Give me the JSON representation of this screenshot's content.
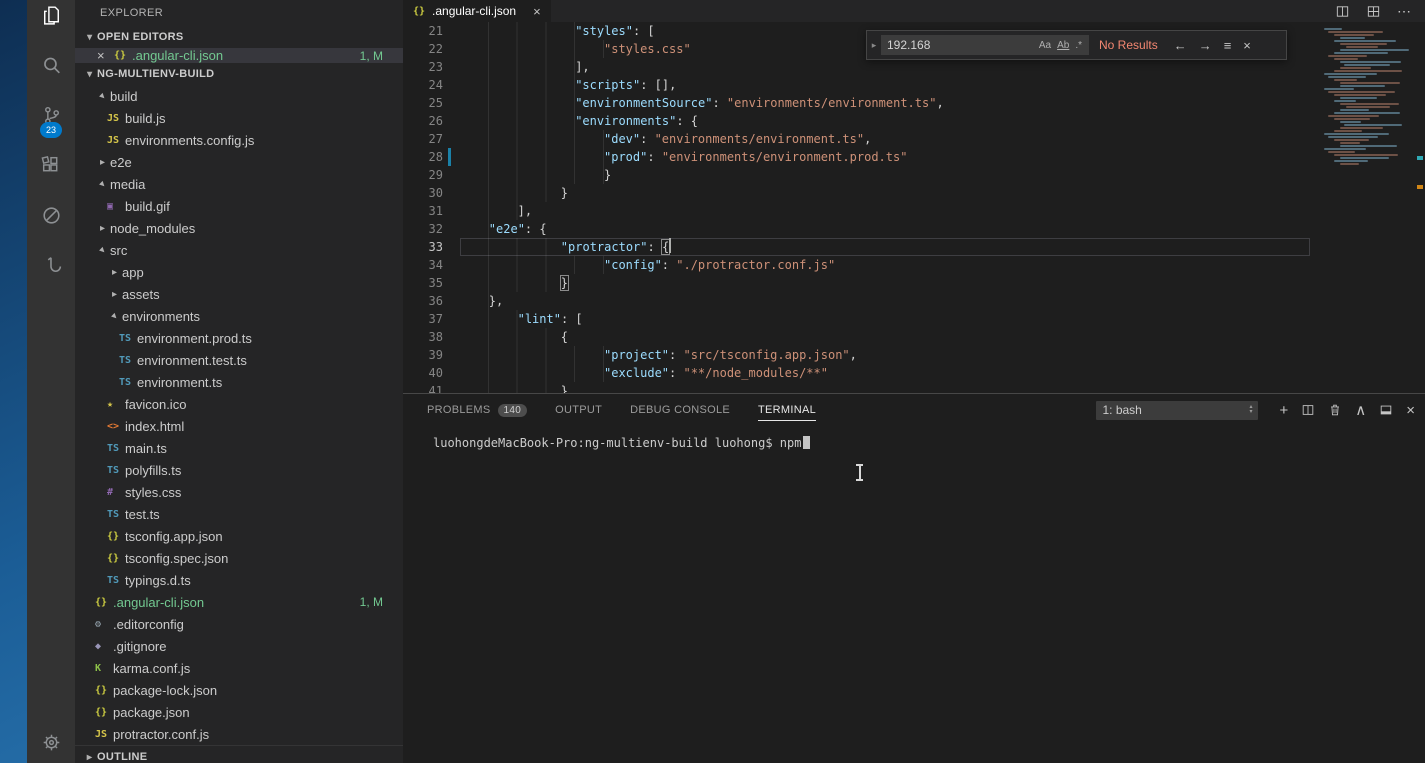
{
  "icons": {
    "close": "×",
    "twisty": "▸",
    "more": "⋯",
    "plus": "+",
    "chevron_up": "∧",
    "find_expand": "▸",
    "prev_match": "←",
    "next_match": "→",
    "find_selection": "≡",
    "select_up": "▴",
    "select_down": "▾"
  },
  "colors": {
    "accent": "#007acc",
    "key": "#9cdcfe",
    "string": "#ce9178",
    "punct": "#d4d4d4",
    "modified": "#73c991",
    "error_text": "#f48771",
    "modified_gutter": "#1b81a8"
  },
  "activity_bar": {
    "scm_badge": "23"
  },
  "sidebar": {
    "title": "EXPLORER",
    "open_editors": {
      "label": "OPEN EDITORS",
      "items": [
        {
          "name": ".angular-cli.json",
          "icon": "{}",
          "icon_color": "#cbcb41",
          "badge": "1, M",
          "status_color": "#73c991"
        }
      ]
    },
    "project_label": "NG-MULTIENV-BUILD",
    "outline_label": "OUTLINE",
    "tree": [
      {
        "kind": "folder",
        "depth": 0,
        "expanded": true,
        "label": "build"
      },
      {
        "kind": "file",
        "depth": 1,
        "icon": "JS",
        "icon_color": "#d6c64a",
        "label": "build.js"
      },
      {
        "kind": "file",
        "depth": 1,
        "icon": "JS",
        "icon_color": "#d6c64a",
        "label": "environments.config.js"
      },
      {
        "kind": "folder",
        "depth": 0,
        "expanded": false,
        "label": "e2e"
      },
      {
        "kind": "folder",
        "depth": 0,
        "expanded": true,
        "label": "media"
      },
      {
        "kind": "file",
        "depth": 1,
        "icon": "▣",
        "icon_color": "#9068b0",
        "label": "build.gif"
      },
      {
        "kind": "folder",
        "depth": 0,
        "expanded": false,
        "label": "node_modules"
      },
      {
        "kind": "folder",
        "depth": 0,
        "expanded": true,
        "label": "src"
      },
      {
        "kind": "folder",
        "depth": 1,
        "expanded": false,
        "label": "app"
      },
      {
        "kind": "folder",
        "depth": 1,
        "expanded": false,
        "label": "assets"
      },
      {
        "kind": "folder",
        "depth": 1,
        "expanded": true,
        "label": "environments"
      },
      {
        "kind": "file",
        "depth": 2,
        "icon": "TS",
        "icon_color": "#519aba",
        "label": "environment.prod.ts"
      },
      {
        "kind": "file",
        "depth": 2,
        "icon": "TS",
        "icon_color": "#519aba",
        "label": "environment.test.ts"
      },
      {
        "kind": "file",
        "depth": 2,
        "icon": "TS",
        "icon_color": "#519aba",
        "label": "environment.ts"
      },
      {
        "kind": "file",
        "depth": 1,
        "icon": "★",
        "icon_color": "#d6c64a",
        "label": "favicon.ico"
      },
      {
        "kind": "file",
        "depth": 1,
        "icon": "<>",
        "icon_color": "#e37933",
        "label": "index.html"
      },
      {
        "kind": "file",
        "depth": 1,
        "icon": "TS",
        "icon_color": "#519aba",
        "label": "main.ts"
      },
      {
        "kind": "file",
        "depth": 1,
        "icon": "TS",
        "icon_color": "#519aba",
        "label": "polyfills.ts"
      },
      {
        "kind": "file",
        "depth": 1,
        "icon": "#",
        "icon_color": "#9068b0",
        "label": "styles.css"
      },
      {
        "kind": "file",
        "depth": 1,
        "icon": "TS",
        "icon_color": "#519aba",
        "label": "test.ts"
      },
      {
        "kind": "file",
        "depth": 1,
        "icon": "{}",
        "icon_color": "#cbcb41",
        "label": "tsconfig.app.json"
      },
      {
        "kind": "file",
        "depth": 1,
        "icon": "{}",
        "icon_color": "#cbcb41",
        "label": "tsconfig.spec.json"
      },
      {
        "kind": "file",
        "depth": 1,
        "icon": "TS",
        "icon_color": "#519aba",
        "label": "typings.d.ts"
      },
      {
        "kind": "file",
        "depth": 0,
        "icon": "{}",
        "icon_color": "#cbcb41",
        "label": ".angular-cli.json",
        "badge": "1, M",
        "status_color": "#73c991"
      },
      {
        "kind": "file",
        "depth": 0,
        "icon": "⚙",
        "icon_color": "#99a8b3",
        "label": ".editorconfig"
      },
      {
        "kind": "file",
        "depth": 0,
        "icon": "◆",
        "icon_color": "#9995b7",
        "label": ".gitignore"
      },
      {
        "kind": "file",
        "depth": 0,
        "icon": "K",
        "icon_color": "#8dc149",
        "label": "karma.conf.js"
      },
      {
        "kind": "file",
        "depth": 0,
        "icon": "{}",
        "icon_color": "#cbcb41",
        "label": "package-lock.json"
      },
      {
        "kind": "file",
        "depth": 0,
        "icon": "{}",
        "icon_color": "#cbcb41",
        "label": "package.json"
      },
      {
        "kind": "file",
        "depth": 0,
        "icon": "JS",
        "icon_color": "#d6c64a",
        "label": "protractor.conf.js"
      }
    ]
  },
  "editor": {
    "tab": {
      "label": ".angular-cli.json",
      "icon": "{}",
      "icon_color": "#cbcb41"
    },
    "find": {
      "value": "192.168",
      "match_case": "Aa",
      "whole_word": "Ab",
      "regex": ".*",
      "results": "No Results"
    },
    "code": {
      "lines": [
        {
          "n": 21,
          "ind": 16,
          "tok": [
            [
              "k",
              "\"styles\""
            ],
            [
              "p",
              ": ["
            ]
          ]
        },
        {
          "n": 22,
          "ind": 20,
          "tok": [
            [
              "s",
              "\"styles.css\""
            ]
          ]
        },
        {
          "n": 23,
          "ind": 16,
          "tok": [
            [
              "p",
              "],"
            ]
          ]
        },
        {
          "n": 24,
          "ind": 16,
          "tok": [
            [
              "k",
              "\"scripts\""
            ],
            [
              "p",
              ": [],"
            ]
          ]
        },
        {
          "n": 25,
          "ind": 16,
          "tok": [
            [
              "k",
              "\"environmentSource\""
            ],
            [
              "p",
              ": "
            ],
            [
              "s",
              "\"environments/environment.ts\""
            ],
            [
              "p",
              ","
            ]
          ]
        },
        {
          "n": 26,
          "ind": 16,
          "tok": [
            [
              "k",
              "\"environments\""
            ],
            [
              "p",
              ": {"
            ]
          ]
        },
        {
          "n": 27,
          "ind": 20,
          "tok": [
            [
              "k",
              "\"dev\""
            ],
            [
              "p",
              ": "
            ],
            [
              "s",
              "\"environments/environment.ts\""
            ],
            [
              "p",
              ","
            ]
          ]
        },
        {
          "n": 28,
          "ind": 20,
          "mod": true,
          "tok": [
            [
              "k",
              "\"prod\""
            ],
            [
              "p",
              ": "
            ],
            [
              "s",
              "\"environments/environment.prod.ts\""
            ]
          ]
        },
        {
          "n": 29,
          "ind": 20,
          "tok": [
            [
              "p",
              "}"
            ]
          ]
        },
        {
          "n": 30,
          "ind": 14,
          "tok": [
            [
              "p",
              "}"
            ]
          ]
        },
        {
          "n": 31,
          "ind": 8,
          "tok": [
            [
              "p",
              "],"
            ]
          ]
        },
        {
          "n": 32,
          "ind": 4,
          "tok": [
            [
              "k",
              "\"e2e\""
            ],
            [
              "p",
              ": {"
            ]
          ]
        },
        {
          "n": 33,
          "ind": 14,
          "current": true,
          "tok": [
            [
              "k",
              "\"protractor\""
            ],
            [
              "p",
              ": "
            ],
            [
              "b",
              "{"
            ],
            [
              "c",
              ""
            ]
          ]
        },
        {
          "n": 34,
          "ind": 20,
          "tok": [
            [
              "k",
              "\"config\""
            ],
            [
              "p",
              ": "
            ],
            [
              "s",
              "\"./protractor.conf.js\""
            ]
          ]
        },
        {
          "n": 35,
          "ind": 14,
          "tok": [
            [
              "b",
              "}"
            ]
          ]
        },
        {
          "n": 36,
          "ind": 4,
          "tok": [
            [
              "p",
              "},"
            ]
          ]
        },
        {
          "n": 37,
          "ind": 8,
          "tok": [
            [
              "k",
              "\"lint\""
            ],
            [
              "p",
              ": ["
            ]
          ]
        },
        {
          "n": 38,
          "ind": 14,
          "tok": [
            [
              "p",
              "{"
            ]
          ]
        },
        {
          "n": 39,
          "ind": 20,
          "tok": [
            [
              "k",
              "\"project\""
            ],
            [
              "p",
              ": "
            ],
            [
              "s",
              "\"src/tsconfig.app.json\""
            ],
            [
              "p",
              ","
            ]
          ]
        },
        {
          "n": 40,
          "ind": 20,
          "tok": [
            [
              "k",
              "\"exclude\""
            ],
            [
              "p",
              ": "
            ],
            [
              "s",
              "\"**/node_modules/**\""
            ]
          ]
        },
        {
          "n": 41,
          "ind": 14,
          "tok": [
            [
              "p",
              "}"
            ]
          ]
        }
      ]
    }
  },
  "panel": {
    "tabs": [
      {
        "label": "PROBLEMS",
        "badge": "140"
      },
      {
        "label": "OUTPUT"
      },
      {
        "label": "DEBUG CONSOLE"
      },
      {
        "label": "TERMINAL",
        "active": true
      }
    ],
    "shell_select": "1: bash",
    "terminal_prompt": "luohongdeMacBook-Pro:ng-multienv-build luohong$ npm"
  }
}
